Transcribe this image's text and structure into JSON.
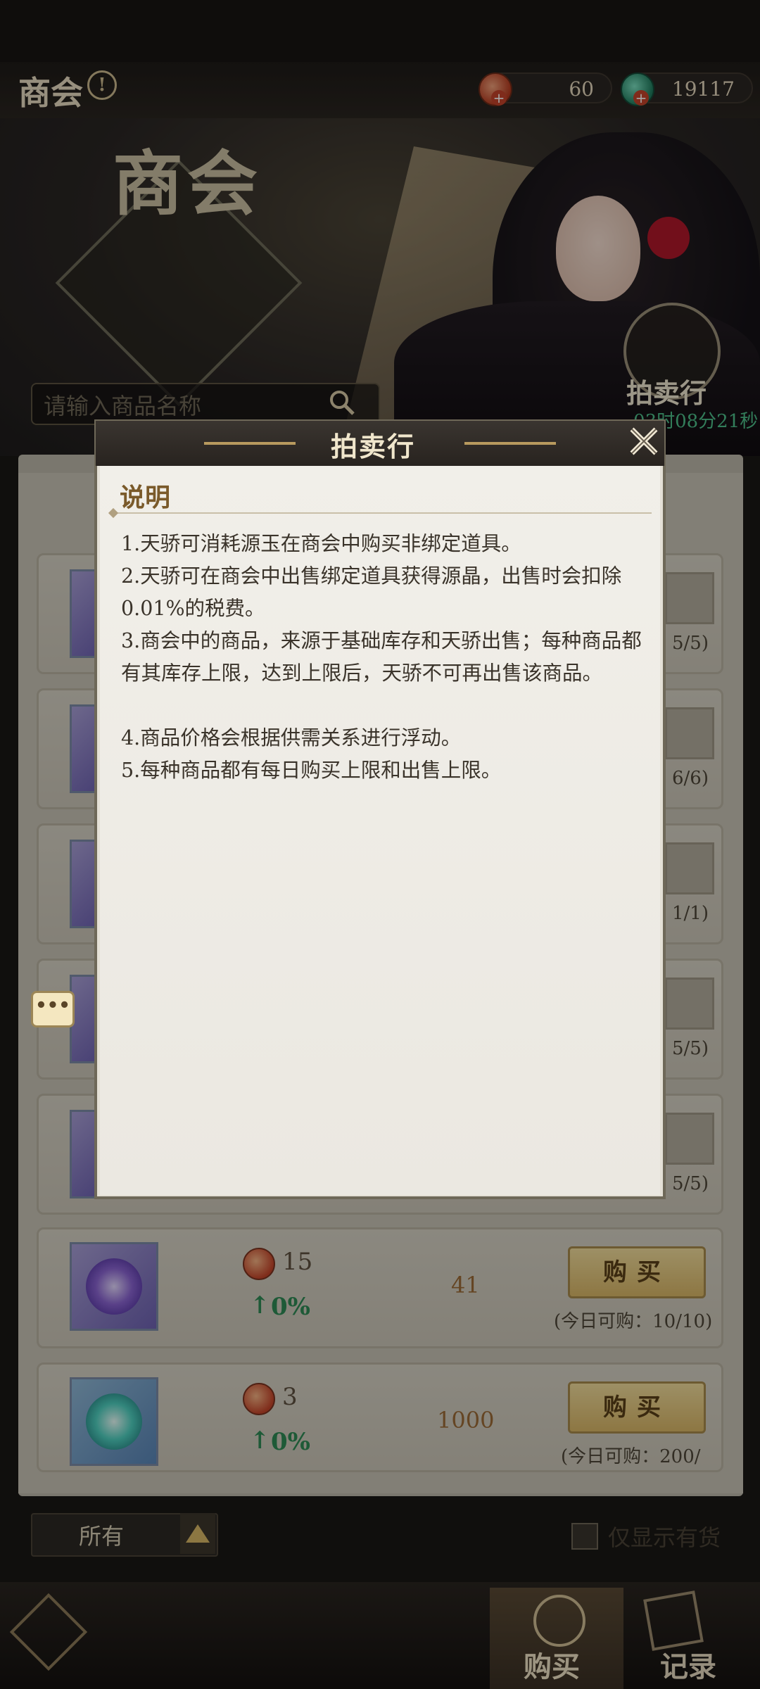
{
  "header": {
    "title": "商会",
    "currency_red": "60",
    "currency_green": "19117"
  },
  "banner": {
    "title": "商会",
    "search_placeholder": "请输入商品名称",
    "auction_label": "拍卖行",
    "countdown": "03时08分21秒"
  },
  "list": {
    "partial_limits": [
      "5/5)",
      "6/6)",
      "1/1)",
      "5/5)",
      "5/5)"
    ],
    "items": [
      {
        "price": "15",
        "change": "0%",
        "stock": "41",
        "buy": "购买",
        "limit": "(今日可购：10/10)"
      },
      {
        "price": "3",
        "change": "0%",
        "stock": "1000",
        "buy": "购买",
        "limit": "(今日可购：200/"
      }
    ]
  },
  "bottom": {
    "filter": "所有",
    "only_in_stock": "仅显示有货"
  },
  "nav": {
    "buy": "购买",
    "record": "记录"
  },
  "modal": {
    "title": "拍卖行",
    "section": "说明",
    "rules": [
      "1.天骄可消耗源玉在商会中购买非绑定道具。",
      "2.天骄可在商会中出售绑定道具获得源晶，出售时会扣除0.01%的税费。",
      "3.商会中的商品，来源于基础库存和天骄出售；每种商品都有其库存上限，达到上限后，天骄不可再出售该商品。",
      "4.商品价格会根据供需关系进行浮动。",
      "5.每种商品都有每日购买上限和出售上限。"
    ]
  },
  "icons": {
    "chat": "chat-bubble-icon",
    "close": "close-icon",
    "search": "search-icon"
  }
}
